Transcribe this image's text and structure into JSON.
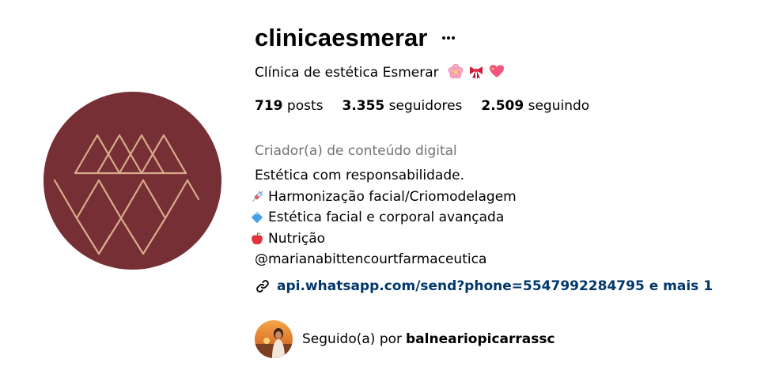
{
  "profile": {
    "username": "clinicaesmerar",
    "full_name": "Clínica de estética Esmerar",
    "name_emojis": [
      "cherry-blossom-emoji",
      "ribbon-emoji",
      "sparkling-heart-emoji"
    ],
    "stats": {
      "posts_count": "719",
      "posts_label": "posts",
      "followers_count": "3.355",
      "followers_label": "seguidores",
      "following_count": "2.509",
      "following_label": "seguindo"
    },
    "category": "Criador(a) de conteúdo digital",
    "bio": {
      "line1": "Estética com responsabilidade.",
      "line2": "Harmonização facial/Criomodelagem",
      "line3": "Estética facial e corporal avançada",
      "line4": "Nutrição",
      "handle": "@marianabittencourtfarmaceutica"
    },
    "bio_icons": [
      "syringe-emoji",
      "blue-diamond-emoji",
      "apple-emoji"
    ],
    "external_link": "api.whatsapp.com/send?phone=5547992284795 e mais 1",
    "followed_by": {
      "prefix": "Seguido(a) por",
      "user": "balneariopicarrassc"
    }
  },
  "colors": {
    "avatar_bg": "#762f35",
    "logo_lines": "#d8ac8a",
    "link": "#00376b",
    "muted": "#737373"
  }
}
